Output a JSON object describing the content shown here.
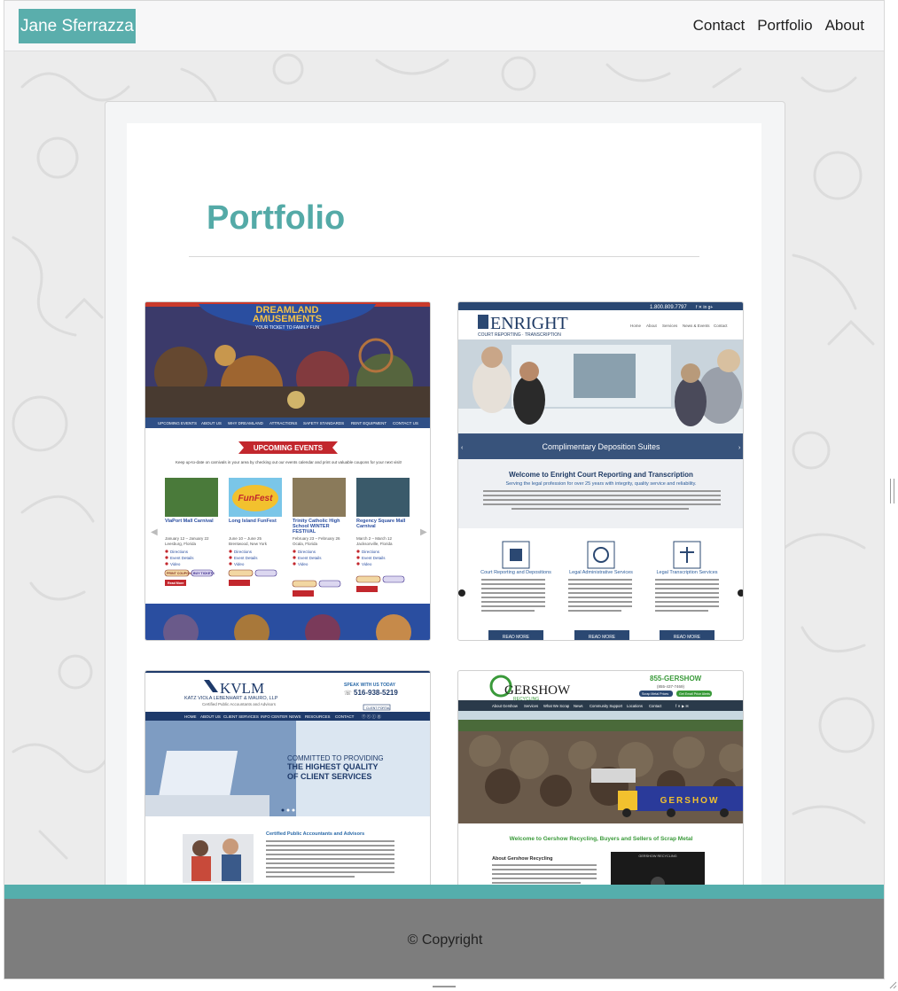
{
  "navbar": {
    "brand": "Jane Sferrazza",
    "links": [
      "Contact",
      "Portfolio",
      "About"
    ]
  },
  "page": {
    "title": "Portfolio"
  },
  "portfolio": {
    "items": [
      {
        "name": "Dreamland Amusements",
        "logo_lines": [
          "DREAMLAND",
          "AMUSEMENTS"
        ],
        "tagline": "YOUR TICKET TO FAMILY FUN",
        "menu": [
          "UPCOMING EVENTS",
          "ABOUT US",
          "WHY DREAMLAND",
          "ATTRACTIONS",
          "SAFETY STANDARDS",
          "RENT EQUIPMENT",
          "CONTACT US"
        ],
        "section_title": "UPCOMING EVENTS",
        "intro": "Keep up-to-date on carnivals in your area by checking out our events calendar and print out valuable coupons for your next visit!",
        "events": [
          {
            "title": "ViaPort Mall Carnival",
            "dates": "January 12 – January 22",
            "place": "Leesburg, Florida"
          },
          {
            "title": "Long Island FunFest",
            "dates": "June 10 – June 25",
            "place": "Brentwood, New York"
          },
          {
            "title": "Trinity Catholic High School WINTER FESTIVAL",
            "dates": "February 23 – February 26",
            "place": "Ocala, Florida"
          },
          {
            "title": "Regency Square Mall Carnival",
            "dates": "March 2 – March 12",
            "place": "Jacksonville, Florida"
          }
        ],
        "event_links": [
          "Directions",
          "Event Details",
          "Video"
        ],
        "buttons": [
          "PRINT COUPONS",
          "BUY TICKETS",
          "Read More"
        ],
        "funfest_badge": "FunFest"
      },
      {
        "name": "Enright Court Reporting",
        "phone": "1.800.809.7797",
        "logo": "ENRIGHT",
        "logo_sub": "COURT REPORTING · TRANSCRIPTION",
        "menu": [
          "Home",
          "About",
          "Services",
          "News & Events",
          "Contact"
        ],
        "banner": "Complimentary Deposition Suites",
        "heading": "Welcome to Enright Court Reporting and Transcription",
        "subheading": "Serving the legal profession for over 25 years with integrity, quality service and reliability.",
        "services": [
          "Court Reporting and Depositions",
          "Legal Administrative Services",
          "Legal Transcription Services"
        ],
        "read_more": "READ MORE"
      },
      {
        "name": "KVLM",
        "logo": "KVLM",
        "firm": "KATZ VIOLA LEBENHART & MAURO, LLP",
        "firm_sub": "Certified Public Accountants and Advisors",
        "speak": "SPEAK WITH US TODAY",
        "phone": "516-938-5219",
        "client_portal": "CLIENT PORTAL",
        "menu": [
          "HOME",
          "ABOUT US",
          "CLIENT SERVICES",
          "INFO CENTER",
          "NEWS",
          "RESOURCES",
          "CONTACT"
        ],
        "hero_lines": [
          "COMMITTED TO PROVIDING",
          "THE HIGHEST QUALITY",
          "OF CLIENT SERVICES"
        ],
        "section": "Certified Public Accountants and Advisors"
      },
      {
        "name": "Gershow Recycling",
        "logo": "GERSHOW",
        "logo_sub": "RECYCLING",
        "phone": "855-GERSHOW",
        "phone_sub": "(855-437-7469)",
        "scrap_btns": [
          "Scrap Metal Prices",
          "Get Email Price Alerts"
        ],
        "menu": [
          "About Gershow",
          "Services",
          "What We Scrap",
          "News",
          "Community Support",
          "Locations",
          "Contact"
        ],
        "truck_text": "GERSHOW",
        "welcome": "Welcome to Gershow Recycling, Buyers and Sellers of Scrap Metal",
        "about": "About Gershow Recycling",
        "video_label": "GERSHOW RECYCLING"
      }
    ]
  },
  "footer": {
    "copyright": "© Copyright"
  },
  "colors": {
    "accent": "#54aaa7",
    "footer": "#7d7d7d",
    "nav_bg": "#f7f7f8"
  }
}
